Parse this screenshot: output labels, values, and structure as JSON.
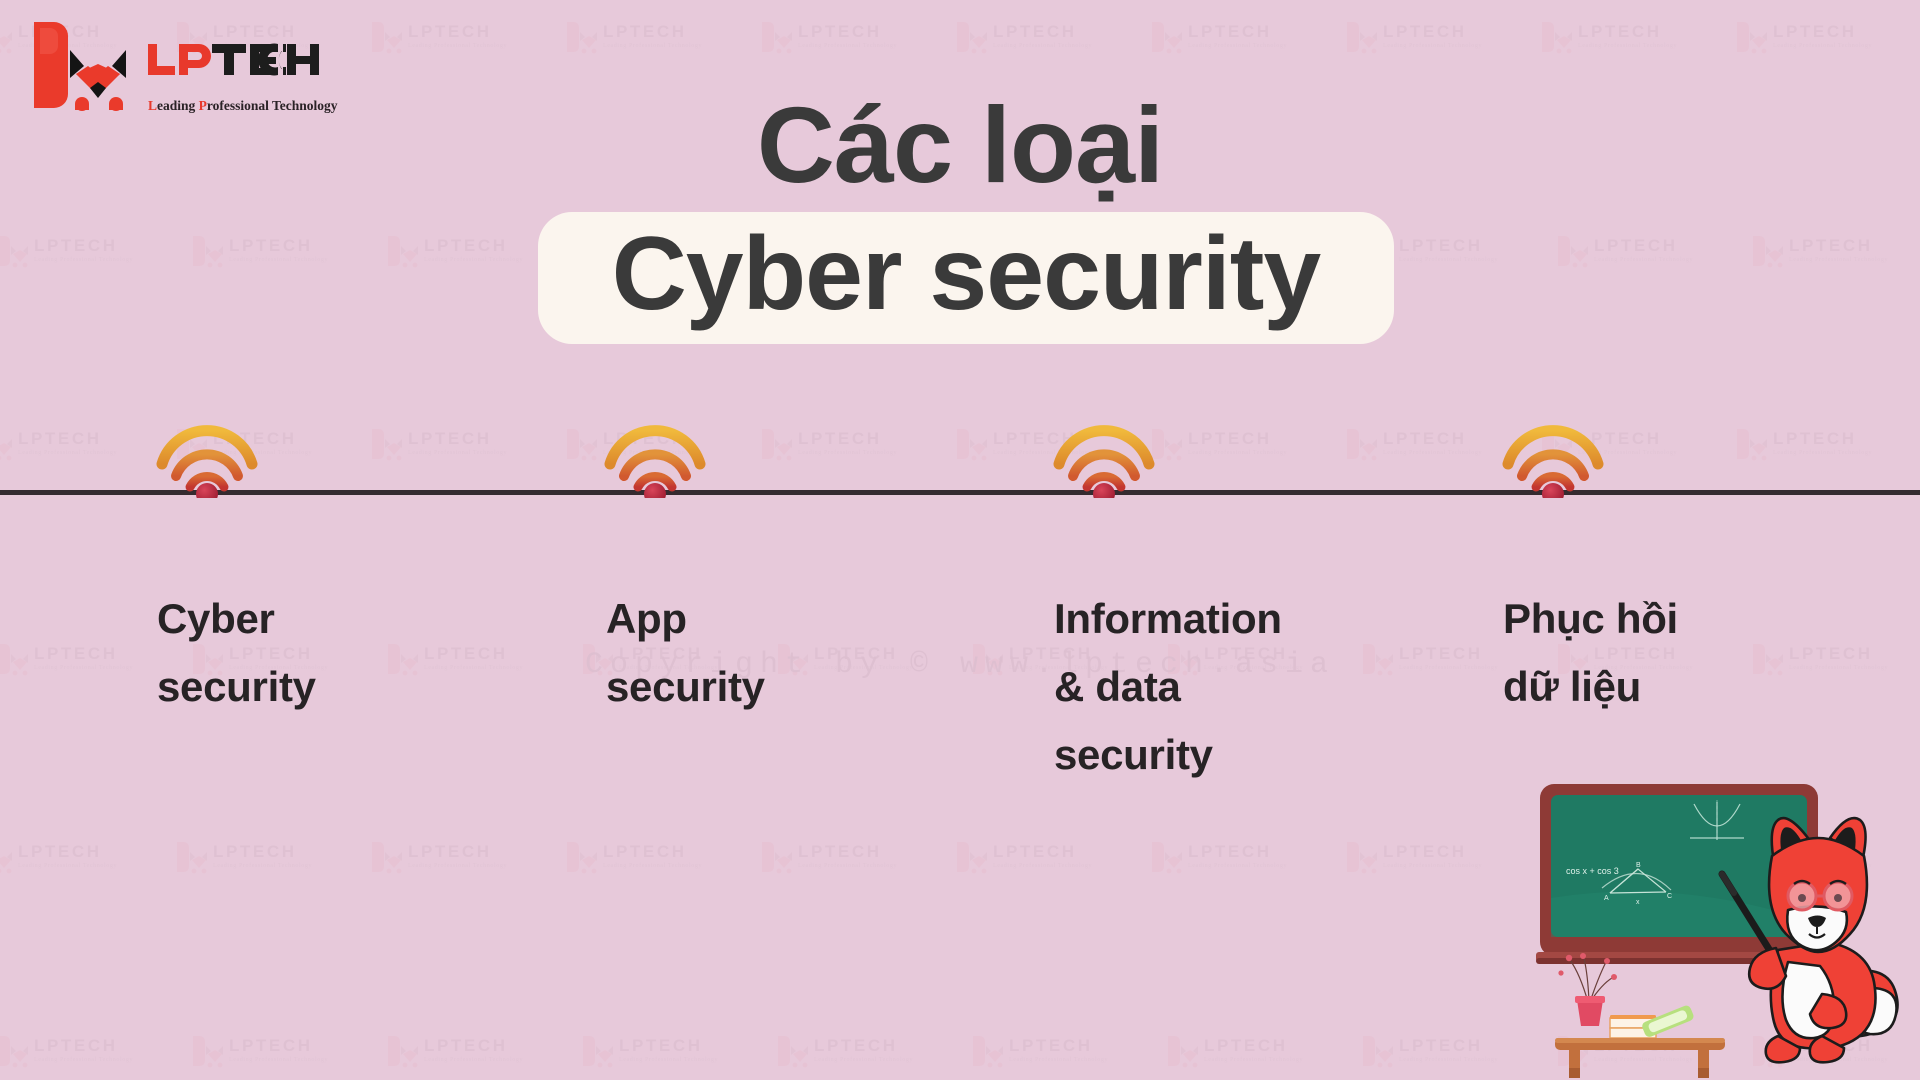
{
  "brand": {
    "name": "LPTECH",
    "tagline_pre": "L",
    "tagline_mid": "eading ",
    "tagline_p": "P",
    "tagline_post": "rofessional Technology",
    "tagline_full": "Leading Professional Technology",
    "mark_icon": "fox-head-logo-icon",
    "colors": {
      "red": "#e8392c",
      "dark": "#1d1d1d"
    }
  },
  "heading": {
    "title": "Các loại",
    "subtitle": "Cyber security",
    "title_color": "#3a3a3a",
    "subtitle_box_color": "#fbf5ee"
  },
  "background": {
    "color": "#e7c9da",
    "rule_color": "#352b30"
  },
  "watermark": {
    "logo_text": "LPTECH",
    "logo_tagline": "Leading Professional Technology",
    "copyright": "Copyright by © www.lptech.asia"
  },
  "timeline": {
    "node_icon": "wifi-signal-icon",
    "node_colors": {
      "arc_outer": "#e9a72c",
      "arc_mid": "#dd7a2b",
      "arc_inner": "#cf4434",
      "dot": "#b8243a"
    },
    "items": [
      {
        "id": "cyber-security",
        "label": "Cyber security",
        "lines": [
          "Cyber",
          "security"
        ]
      },
      {
        "id": "app-security",
        "label": "App security",
        "lines": [
          "App",
          "security"
        ]
      },
      {
        "id": "information-data-security",
        "label": "Information & data security",
        "lines": [
          "Information",
          "& data",
          "security"
        ]
      },
      {
        "id": "phuc-hoi-du-lieu",
        "label": "Phục hồi dữ liệu",
        "lines": [
          "Phục hồi",
          "dữ liệu"
        ]
      }
    ]
  },
  "illustration": {
    "name": "fox-teacher-chalkboard",
    "chalkboard": {
      "equation": "cos x + cos 3",
      "point_labels": [
        "A",
        "B",
        "C",
        "x"
      ],
      "board_color": "#1f7a63",
      "frame_color": "#8e3a36"
    },
    "fox": {
      "name": "fox-mascot-icon",
      "fur_color": "#ef4136",
      "glasses_color": "#f2a3a8"
    },
    "desk_items": [
      "potted-plant",
      "stacked-books",
      "green-book"
    ]
  }
}
